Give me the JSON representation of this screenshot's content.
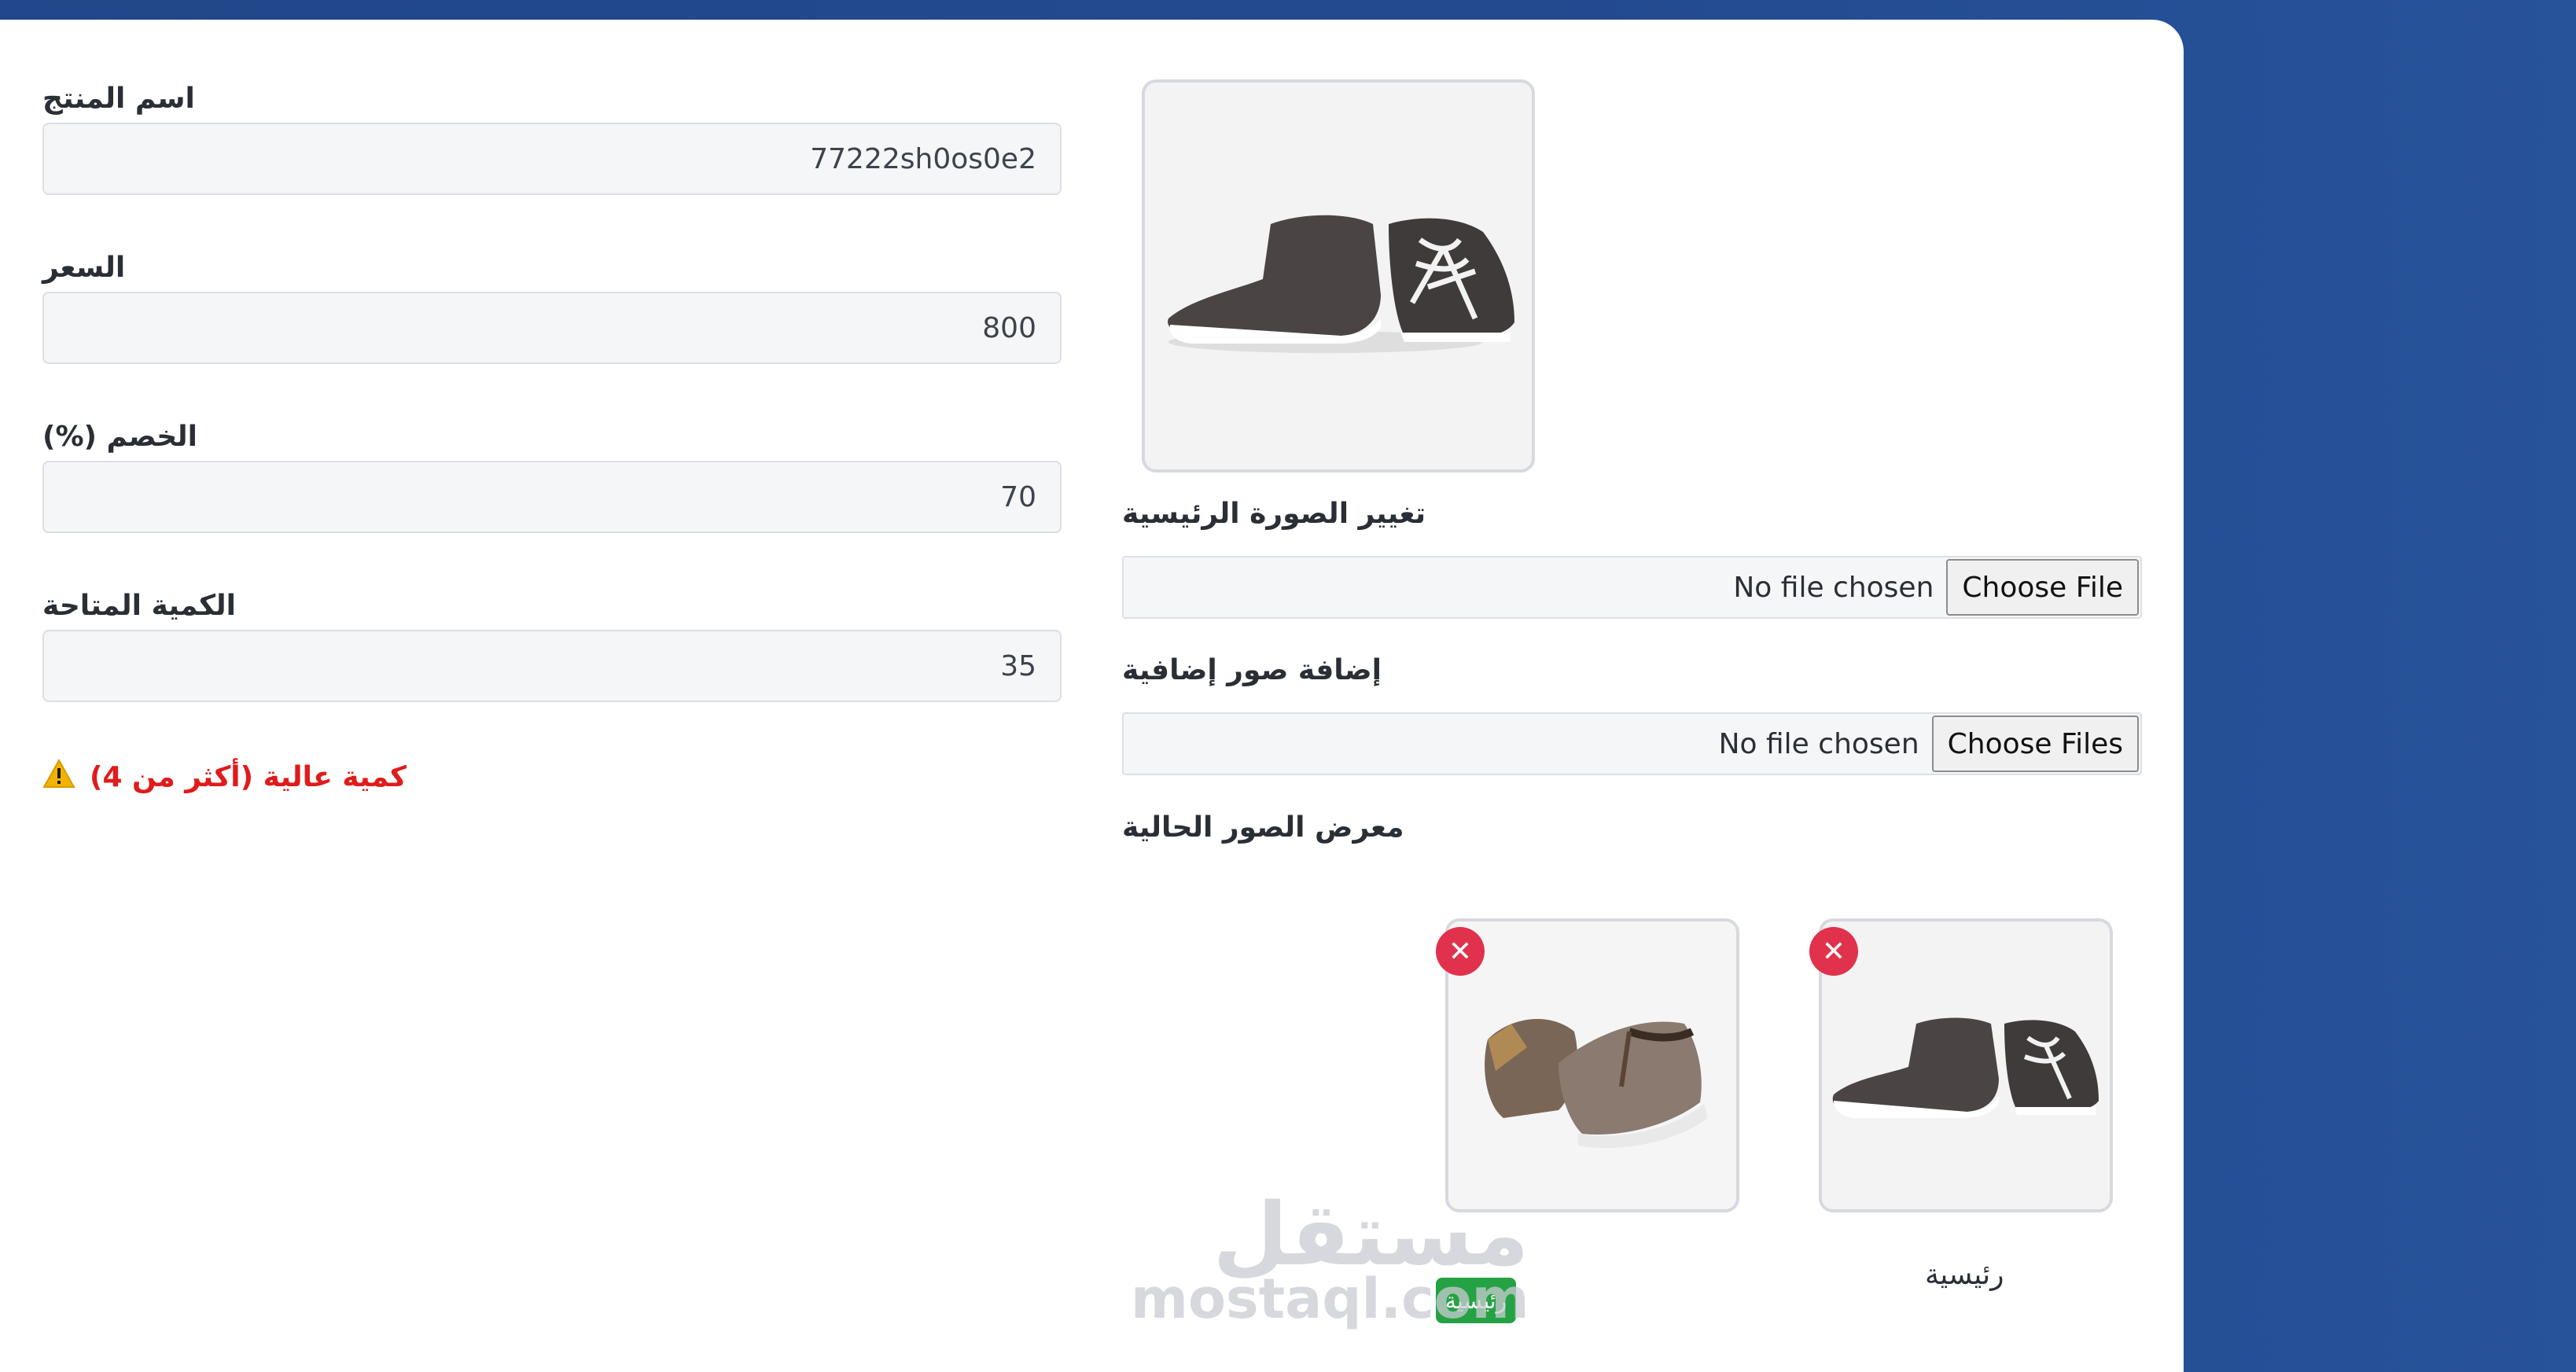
{
  "form": {
    "name_label": "اسم المنتج",
    "name_value": "77222sh0os0e2",
    "price_label": "السعر",
    "price_value": "800",
    "discount_label": "الخصم (%)",
    "discount_value": "70",
    "qty_label": "الكمية المتاحة",
    "qty_value": "35",
    "qty_warning": "كمية عالية (أكثر من 4)"
  },
  "images": {
    "change_main_label": "تغيير الصورة الرئيسية",
    "main_no_file": "No file chosen",
    "main_choose": "Choose File",
    "add_more_label": "إضافة صور إضافية",
    "more_no_file": "No file chosen",
    "more_choose": "Choose Files",
    "gallery_label": "معرض الصور الحالية",
    "gallery_badge": "رئيسية",
    "gallery_caption": "رئيسية"
  },
  "watermark": {
    "arabic": "مستقل",
    "latin": "mostaql.com"
  },
  "colors": {
    "background": "#234a8f",
    "danger": "#e0324c",
    "warning_text": "#e01b1b",
    "badge": "#25a244"
  }
}
